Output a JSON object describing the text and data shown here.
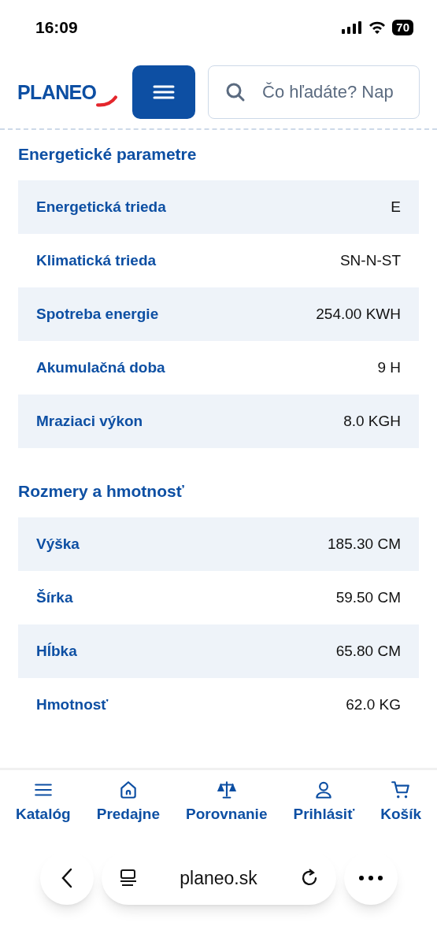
{
  "status_bar": {
    "time": "16:09",
    "battery": "70"
  },
  "header": {
    "logo": "PLANEO",
    "search": {
      "placeholder": "Čo hľadáte? Nap"
    }
  },
  "sections": [
    {
      "title": "Energetické parametre",
      "rows": [
        {
          "label": "Energetická trieda",
          "value": "E"
        },
        {
          "label": "Klimatická trieda",
          "value": "SN-N-ST"
        },
        {
          "label": "Spotreba energie",
          "value": "254.00 KWH"
        },
        {
          "label": "Akumulačná doba",
          "value": "9 H"
        },
        {
          "label": "Mraziaci výkon",
          "value": "8.0 KGH"
        }
      ]
    },
    {
      "title": "Rozmery a hmotnosť",
      "rows": [
        {
          "label": "Výška",
          "value": "185.30 CM"
        },
        {
          "label": "Šírka",
          "value": "59.50 CM"
        },
        {
          "label": "Hĺbka",
          "value": "65.80 CM"
        },
        {
          "label": "Hmotnosť",
          "value": "62.0 KG"
        }
      ]
    }
  ],
  "bottom_nav": [
    {
      "kind": "catalog",
      "label": "Katalóg"
    },
    {
      "kind": "stores",
      "label": "Predajne"
    },
    {
      "kind": "compare",
      "label": "Porovnanie"
    },
    {
      "kind": "login",
      "label": "Prihlásiť"
    },
    {
      "kind": "cart",
      "label": "Košík"
    }
  ],
  "browser_bar": {
    "url": "planeo.sk"
  }
}
